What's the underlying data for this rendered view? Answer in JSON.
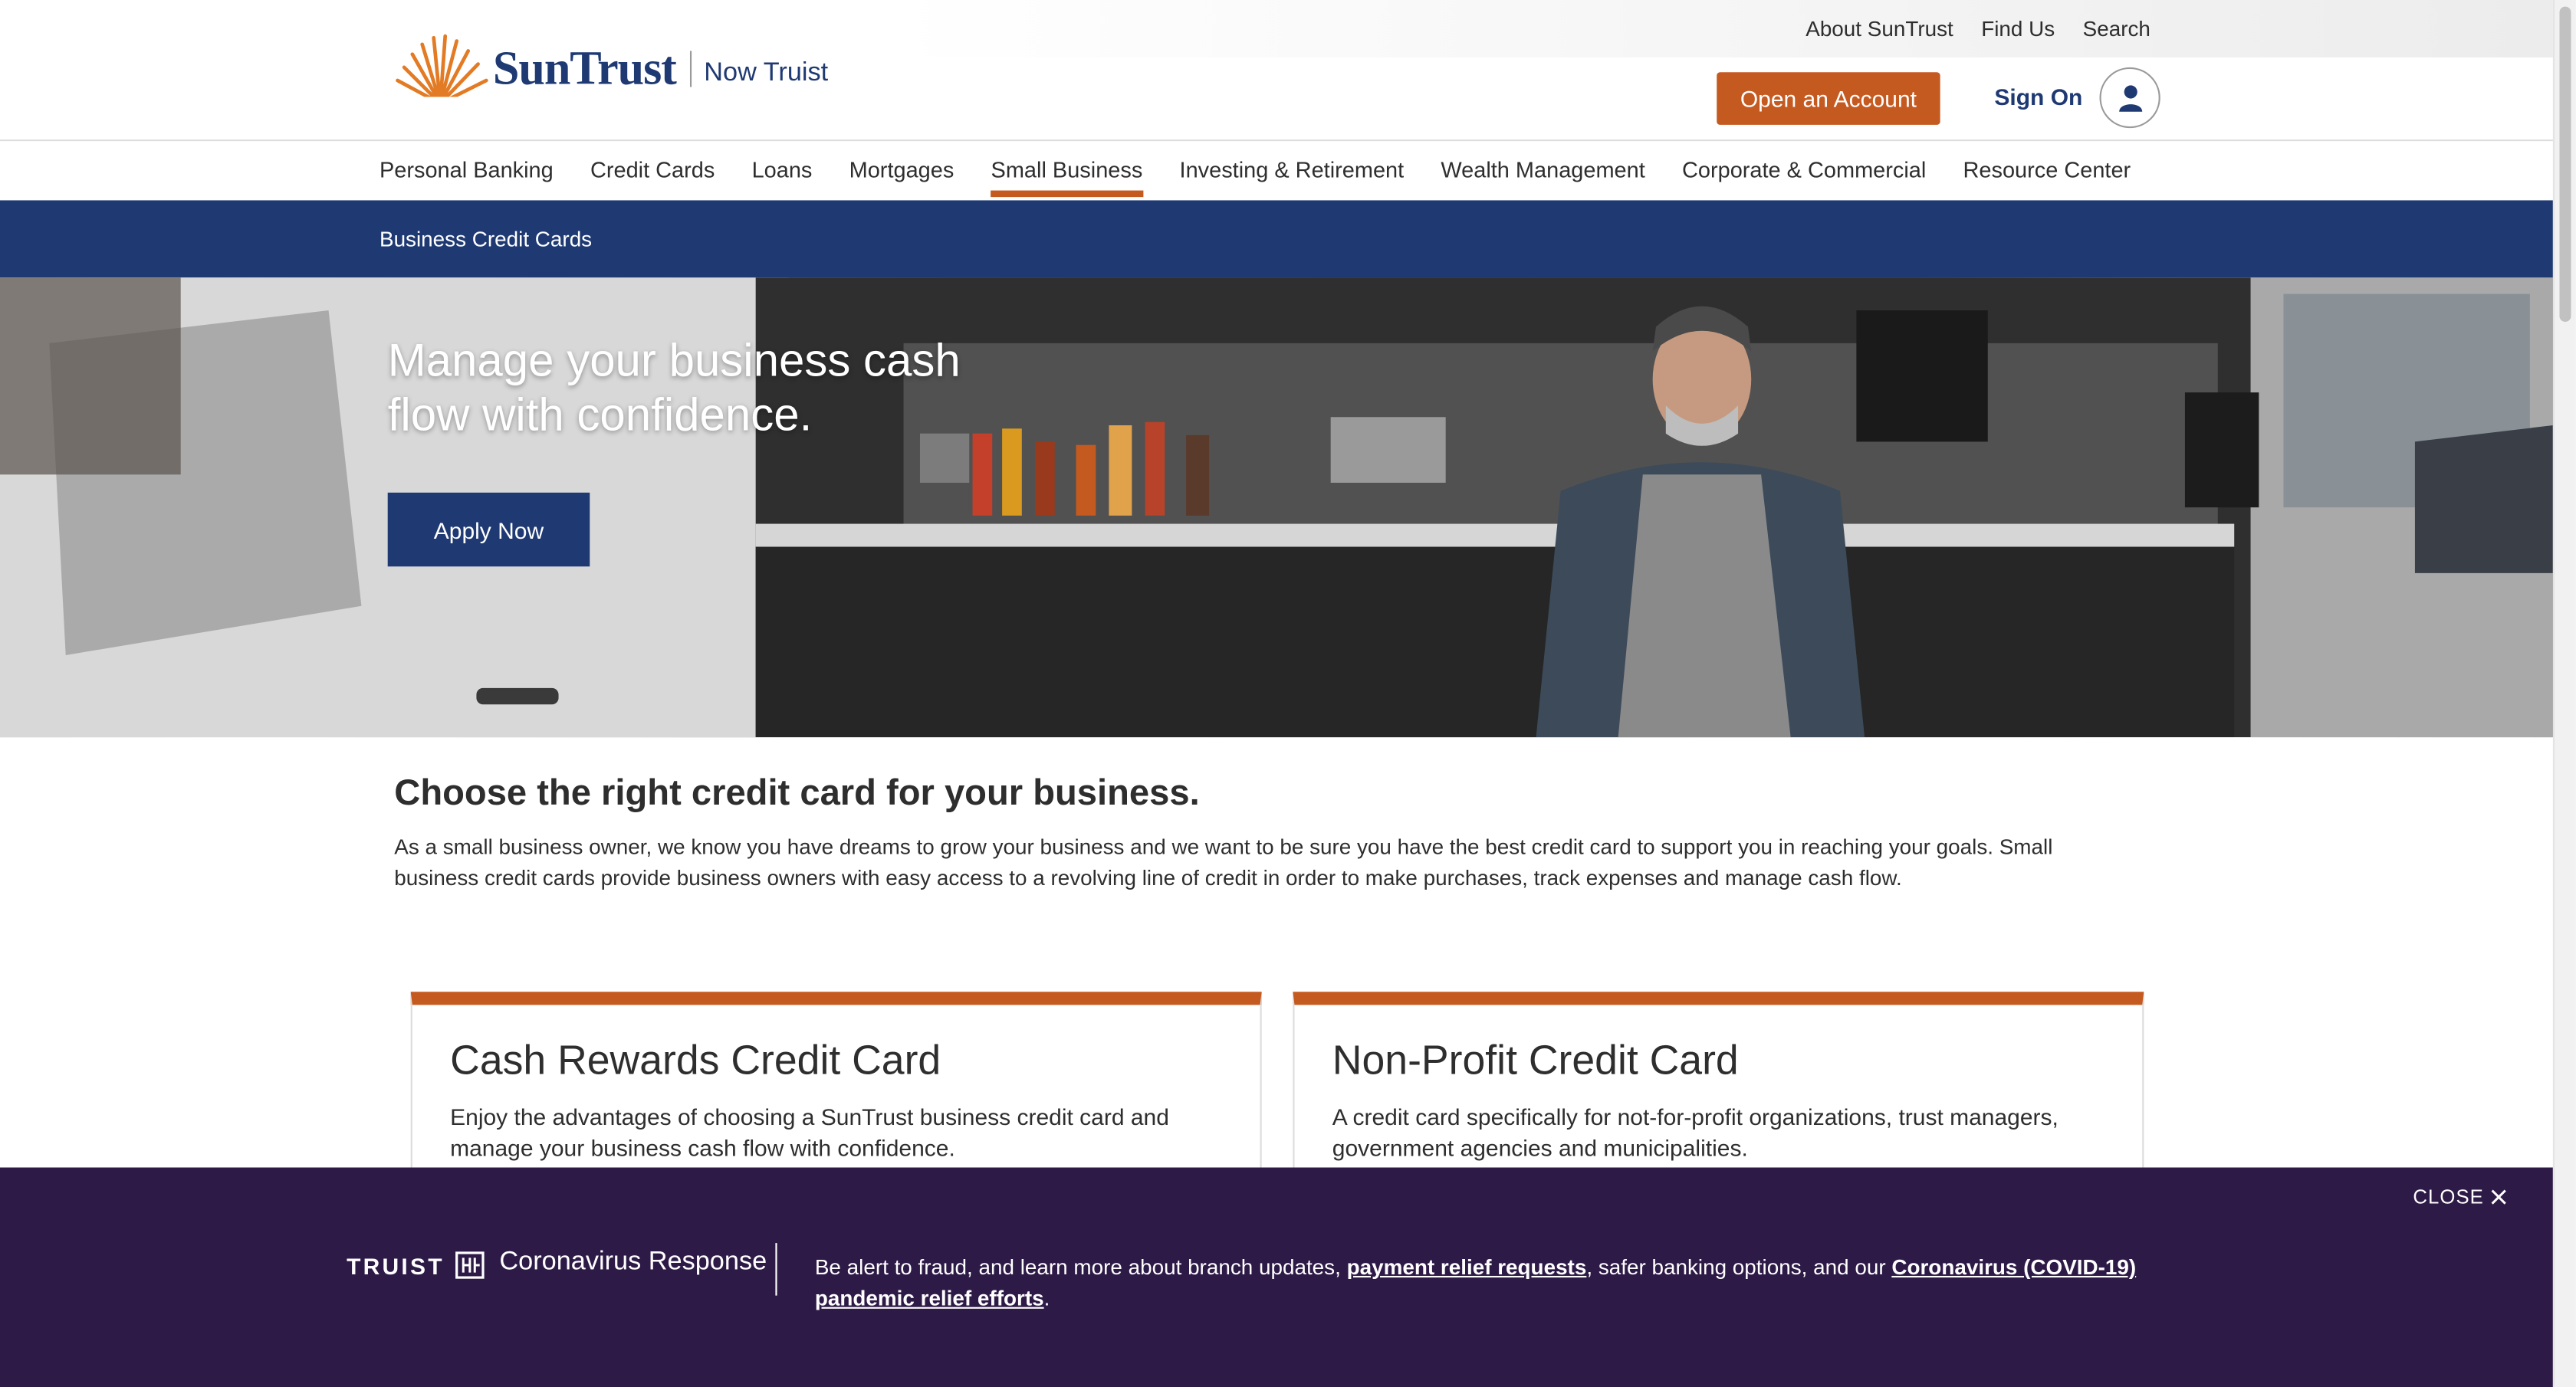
{
  "utility": {
    "links": [
      "About SunTrust",
      "Find Us",
      "Search"
    ]
  },
  "header": {
    "logo_word": "SunTrust",
    "logo_tagline": "Now Truist",
    "open_account": "Open an Account",
    "sign_on": "Sign On"
  },
  "nav": {
    "items": [
      "Personal Banking",
      "Credit Cards",
      "Loans",
      "Mortgages",
      "Small Business",
      "Investing & Retirement",
      "Wealth Management",
      "Corporate & Commercial",
      "Resource Center"
    ],
    "active": "Small Business"
  },
  "subnav": {
    "label": "Business Credit Cards"
  },
  "hero": {
    "title": "Manage your business cash flow with confidence.",
    "cta": "Apply Now"
  },
  "intro": {
    "title": "Choose the right credit card for your business.",
    "text": "As a small business owner, we know you have dreams to grow your business and we want to be sure you have the best credit card to support you in reaching your goals. Small business credit cards provide business owners with easy access to a revolving line of credit in order to make purchases, track expenses and manage cash flow."
  },
  "cards": [
    {
      "title": "Cash Rewards Credit Card",
      "text": "Enjoy the advantages of choosing a SunTrust business credit card and manage your business cash flow with confidence."
    },
    {
      "title": "Non-Profit Credit Card",
      "text": "A credit card specifically for not-for-profit organizations, trust managers, government agencies and municipalities."
    }
  ],
  "banner": {
    "close": "CLOSE",
    "brand": "TRUIST",
    "label": "Coronavirus Response",
    "text_before": "Be alert to fraud, and learn more about branch updates, ",
    "link1": "payment relief requests",
    "text_middle": ", safer banking options, and our ",
    "link2": "Coronavirus (COVID-19) pandemic relief efforts",
    "text_after": "."
  },
  "colors": {
    "brand_blue": "#1f3a73",
    "accent_orange": "#c55a21",
    "banner_purple": "#2e1a47"
  },
  "icons": [
    "suntrust-sun-logo",
    "user-icon",
    "close-icon",
    "truist-logo-mark"
  ]
}
